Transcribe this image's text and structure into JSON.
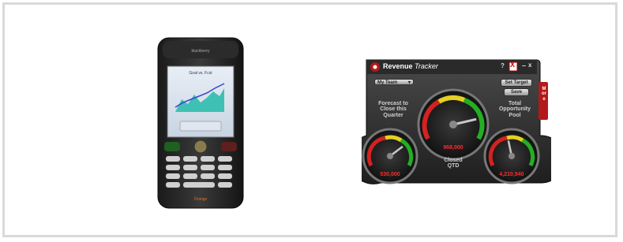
{
  "phone": {
    "brand": "BlackBerry",
    "screen_title": "Goal vs. Fcst",
    "carrier": "Orange"
  },
  "widget": {
    "title_word1": "Revenue",
    "title_word2": "Tracker",
    "help_label": "?",
    "minimize_label": "–",
    "close_label": "x",
    "dropdown_value": "My Team",
    "set_target_label": "Set Target",
    "save_label": "Save",
    "more_label": "More",
    "left_gauge": {
      "label": "Forecast to Close this Quarter",
      "value": "530,000",
      "level": 0.72
    },
    "center_gauge": {
      "label": "Closed QTD",
      "value": "968,000",
      "level": 0.82
    },
    "right_gauge": {
      "label": "Total Opportunity Pool",
      "value": "4,210,940",
      "level": 0.45
    }
  }
}
